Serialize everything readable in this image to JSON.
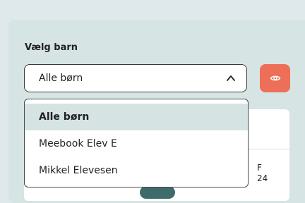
{
  "selector": {
    "label": "Vælg barn",
    "selected_value": "Alle børn",
    "options": [
      "Alle børn",
      "Meebook Elev E",
      "Mikkel Elevesen"
    ]
  },
  "calendar": {
    "day_letter": "F",
    "day_number": "24"
  },
  "icons": {
    "dropdown": "chevron-up-icon",
    "view": "eye-icon"
  },
  "colors": {
    "accent": "#ee6f57",
    "selected_row": "#d5e4e3"
  }
}
